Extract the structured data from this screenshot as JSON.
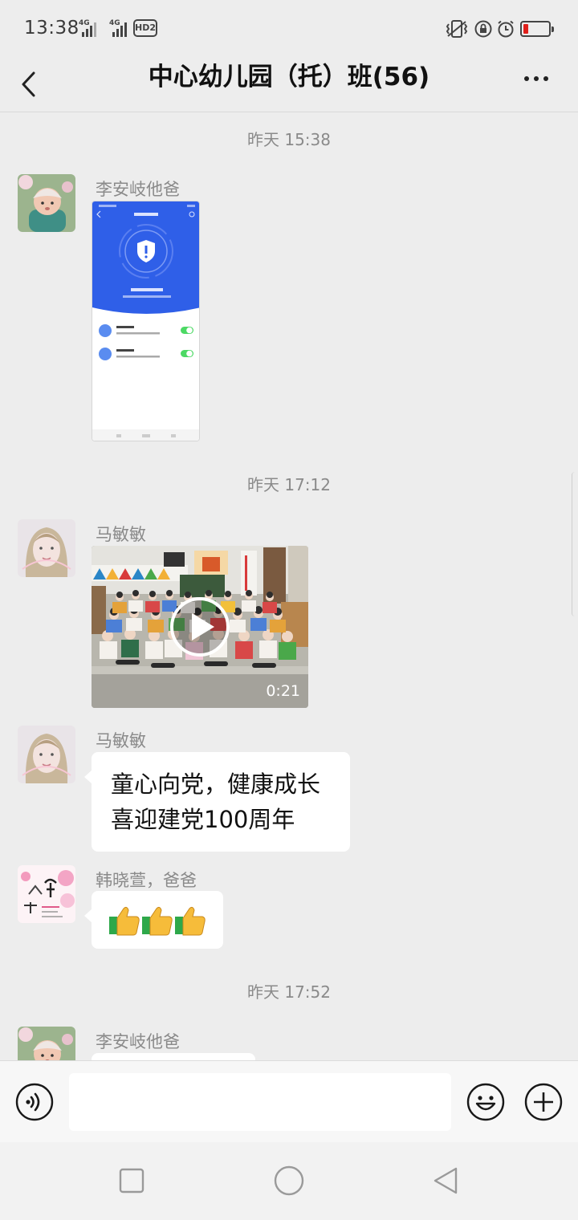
{
  "status_bar": {
    "time": "13:38",
    "sim1_label": "4G",
    "sim2_label": "4G",
    "hd_label": "HD2",
    "battery_level": 0.2,
    "battery_color": "#e0201b",
    "icons": [
      "vibrate-icon",
      "rotation-lock-icon",
      "alarm-icon",
      "battery-icon"
    ]
  },
  "header": {
    "title": "中心幼儿园（托）班(56)",
    "back_icon": "chevron-left-icon",
    "more_icon": "more-dots-icon"
  },
  "chat": {
    "timestamps": [
      "昨天 15:38",
      "昨天 17:12",
      "昨天 17:52"
    ],
    "messages": [
      {
        "sender": "李安岐他爸",
        "type": "image",
        "avatar": "baby-photo"
      },
      {
        "sender": "马敏敏",
        "type": "video",
        "duration": "0:21",
        "avatar": "woman-photo"
      },
      {
        "sender": "马敏敏",
        "type": "text",
        "lines": [
          "童心向党，健康成长",
          "喜迎建党100周年"
        ],
        "avatar": "woman-photo"
      },
      {
        "sender": "韩晓萱，爸爸",
        "type": "text",
        "emoji": [
          "thumbs-up",
          "thumbs-up",
          "thumbs-up"
        ],
        "avatar": "name-card"
      },
      {
        "sender": "李安岐他爸",
        "type": "text",
        "avatar": "baby-photo"
      }
    ]
  },
  "input_bar": {
    "placeholder": "",
    "voice_icon": "voice-icon",
    "emoji_icon": "emoji-icon",
    "plus_icon": "plus-icon"
  },
  "system_nav": [
    "recents-button",
    "home-button",
    "back-button"
  ],
  "colors": {
    "background": "#ededed",
    "bubble": "#ffffff",
    "accent_blue": "#2f5fe8",
    "toggle_green": "#4cd964"
  }
}
